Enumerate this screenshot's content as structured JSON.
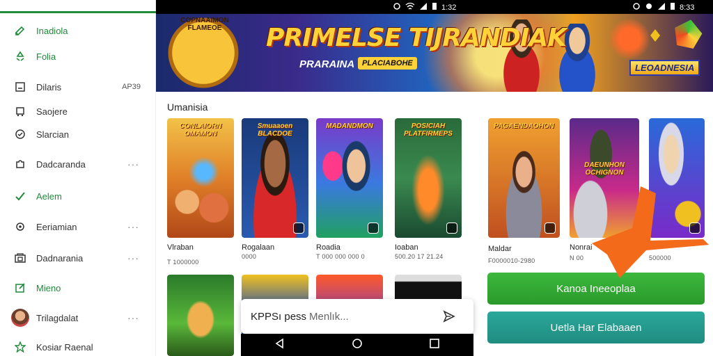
{
  "status": {
    "left_time": "1:32",
    "right_time": "8:33"
  },
  "sidebar": {
    "items": [
      {
        "label": "Inadiola",
        "icon": "pencil-icon",
        "section": true
      },
      {
        "label": "Folia",
        "icon": "recycle-icon",
        "section": true
      },
      {
        "label": "Dilaris",
        "icon": "square-icon",
        "right": "AP39"
      },
      {
        "label": "Saojere",
        "icon": "cart-icon"
      },
      {
        "label": "Slarcian",
        "icon": "check-shield-icon"
      },
      {
        "label": "Dadcaranda",
        "icon": "puzzle-icon",
        "more": true
      },
      {
        "label": "Aelem",
        "icon": "check-icon",
        "section": true
      },
      {
        "label": "Eeriamian",
        "icon": "gear-icon",
        "more": true
      },
      {
        "label": "Dadnarania",
        "icon": "store-icon",
        "more": true
      },
      {
        "label": "Mieno",
        "icon": "edit-icon",
        "section": true
      },
      {
        "label": "Trilagdalat",
        "icon": "avatar",
        "more": true
      },
      {
        "label": "Kosiar Raenal",
        "icon": "star-icon"
      }
    ],
    "more_glyph": "···"
  },
  "banner": {
    "badge_text": "COPNAAIMON FLAMEOE",
    "title": "PRIMELSE TIJRANDIAK",
    "subtitle": "PRARAINA",
    "tag": "PLACIABOHE",
    "cta": "LEOADNESIA"
  },
  "section": {
    "title": "Umanisia"
  },
  "games": [
    {
      "title": "CONLAIORN OMAMON",
      "name": "Vlraban",
      "meta": "T 1000000"
    },
    {
      "title": "Smuaaoen BLACDOE",
      "name": "Rogalaan",
      "meta": "0000"
    },
    {
      "title": "MADANDMON",
      "name": "Roadia",
      "meta": "T 000 000 000 0"
    },
    {
      "title": "POSICIAH PLATFIRMEPS",
      "name": "Ioaban",
      "meta": "500.20 17 21.24"
    },
    {
      "title": "PAGAENDAOHON",
      "name": "Maldar",
      "meta": "F0000010-2980"
    },
    {
      "title": "DAEUNHON OCHIGNON",
      "name": "Nonrai",
      "meta": "N 00"
    },
    {
      "title": "",
      "name": "",
      "meta": "500000"
    }
  ],
  "search": {
    "value": "KPPSı pess",
    "placeholder": "Menlık..."
  },
  "buttons": {
    "primary": "Kanoa Ineeoplaa",
    "secondary": "Uetla Har Elabaaen"
  }
}
